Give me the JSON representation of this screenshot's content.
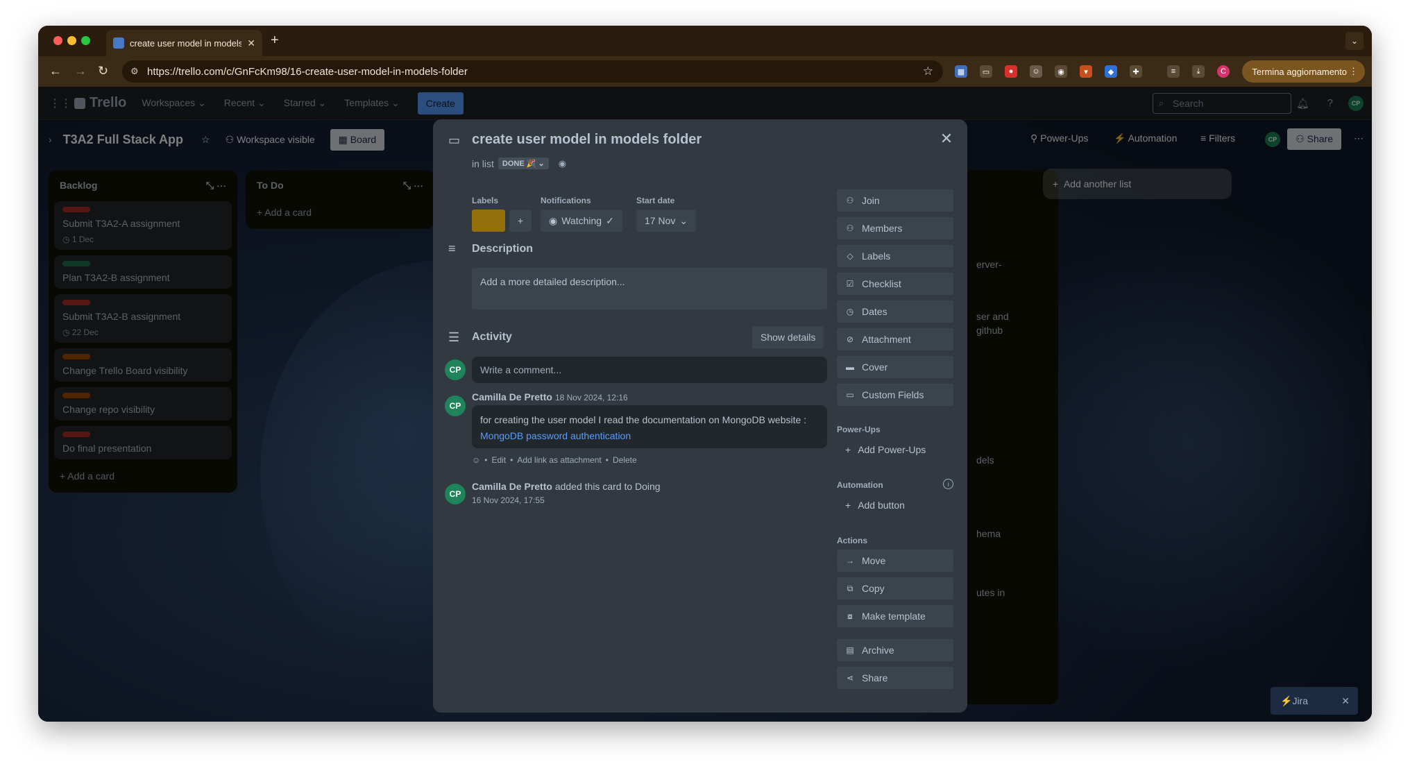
{
  "browser": {
    "tab_title": "create user model in models",
    "url": "https://trello.com/c/GnFcKm98/16-create-user-model-in-models-folder",
    "update_button": "Termina aggiornamento",
    "ext_avatar_letter": "C"
  },
  "header": {
    "logo": "Trello",
    "menus": [
      "Workspaces",
      "Recent",
      "Starred",
      "Templates"
    ],
    "create": "Create",
    "search_placeholder": "Search",
    "avatar": "CP"
  },
  "board": {
    "name": "T3A2 Full Stack App",
    "visibility": "Workspace visible",
    "view": "Board",
    "power_ups": "Power-Ups",
    "automation": "Automation",
    "filters": "Filters",
    "share": "Share",
    "add_list": "Add another list",
    "jira": "Jira"
  },
  "lists": [
    {
      "title": "Backlog",
      "cards": [
        {
          "title": "Submit T3A2-A assignment",
          "label_color": "#ae2e24",
          "date": "1 Dec"
        },
        {
          "title": "Plan T3A2-B assignment",
          "label_color": "#216e4e",
          "date": ""
        },
        {
          "title": "Submit T3A2-B assignment",
          "label_color": "#ae2e24",
          "date": "22 Dec"
        },
        {
          "title": "Change Trello Board visibility",
          "label_color": "#a54800",
          "date": ""
        },
        {
          "title": "Change repo visibility",
          "label_color": "#a54800",
          "date": ""
        },
        {
          "title": "Do final presentation",
          "label_color": "#ae2e24",
          "date": ""
        }
      ],
      "add_card": "Add a card"
    },
    {
      "title": "To Do",
      "cards": [],
      "add_card": "Add a card"
    }
  ],
  "right_fragments": [
    "erver-",
    "ser and",
    "github",
    "dels",
    "hema",
    "utes in"
  ],
  "modal": {
    "title": "create user model in models folder",
    "in_list_prefix": "in list",
    "list_name": "DONE 🎉",
    "labels_heading": "Labels",
    "label_color": "#946f0b",
    "notifications_heading": "Notifications",
    "watching": "Watching",
    "start_date_heading": "Start date",
    "start_date": "17 Nov",
    "description_heading": "Description",
    "description_placeholder": "Add a more detailed description...",
    "activity_heading": "Activity",
    "show_details": "Show details",
    "comment_placeholder": "Write a comment...",
    "comment": {
      "author": "Camilla De Pretto",
      "avatar": "CP",
      "timestamp": "18 Nov 2024, 12:16",
      "text": "for creating the user model I read the documentation on MongoDB website :",
      "link": "MongoDB password authentication",
      "actions": [
        "Edit",
        "Add link as attachment",
        "Delete"
      ]
    },
    "activity_entry": {
      "author": "Camilla De Pretto",
      "avatar": "CP",
      "action": "added this card to Doing",
      "timestamp": "16 Nov 2024, 17:55"
    },
    "sidebar": {
      "buttons": [
        "Join",
        "Members",
        "Labels",
        "Checklist",
        "Dates",
        "Attachment",
        "Cover",
        "Custom Fields"
      ],
      "power_ups_heading": "Power-Ups",
      "add_power_ups": "Add Power-Ups",
      "automation_heading": "Automation",
      "add_button": "Add button",
      "actions_heading": "Actions",
      "actions": [
        "Move",
        "Copy",
        "Make template",
        "Archive",
        "Share"
      ]
    }
  }
}
